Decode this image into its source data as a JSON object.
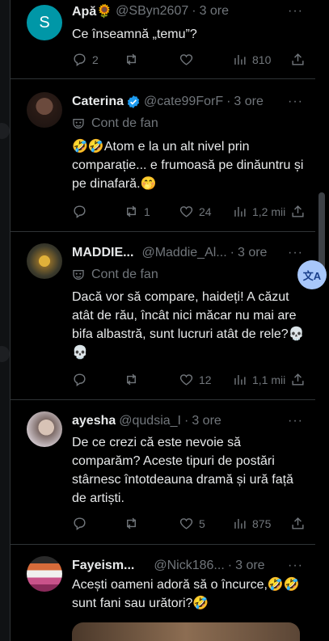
{
  "tweets": [
    {
      "avatar_letter": "S",
      "name": "Apă🌻",
      "handle": "@SByn2607",
      "dot": "·",
      "time": "3 ore",
      "text": "Ce înseamnă „temu”?",
      "replies": "2",
      "retweets": "",
      "likes": "",
      "views": "810"
    },
    {
      "name": "Caterina",
      "verified": true,
      "handle": "@cate99ForF",
      "dot": "·",
      "time": "3 ore",
      "fan_label": "Cont de fan",
      "text": "🤣🤣Atom e la un alt nivel prin comparație... e frumoasă pe dinăuntru și pe dinafară.🤭",
      "replies": "",
      "retweets": "1",
      "likes": "24",
      "views": "1,2 mii"
    },
    {
      "name": "MADDIE...",
      "handle": "@Maddie_Al...",
      "dot": "·",
      "time": "3 ore",
      "fan_label": "Cont de fan",
      "text": "Dacă vor să compare, haideți! A căzut atât de rău, încât nici măcar nu mai are bifa albastră, sunt lucruri atât de rele?💀💀",
      "replies": "",
      "retweets": "",
      "likes": "12",
      "views": "1,1 mii"
    },
    {
      "name": "ayesha",
      "handle": "@qudsia_I",
      "dot": "·",
      "time": "3 ore",
      "text": "De ce crezi că este nevoie să comparăm? Aceste tipuri de postări stârnesc întotdeauna dramă și ură față de artiști.",
      "replies": "",
      "retweets": "",
      "likes": "5",
      "views": "875"
    },
    {
      "name": "Fayeism...",
      "handle": "@Nick186...",
      "dot": "·",
      "time": "3 ore",
      "text": "Acești oameni adoră să o încurce,🤣🤣sunt fani sau urători?🤣",
      "replies": "",
      "retweets": "",
      "likes": "",
      "views": ""
    }
  ],
  "ui": {
    "more_label": "···",
    "translate_label": "文A"
  },
  "colors": {
    "background": "#000000",
    "text": "#e7e9ea",
    "muted": "#71767b",
    "verified": "#1d9bf0",
    "avatar_teal": "#0097a7"
  }
}
